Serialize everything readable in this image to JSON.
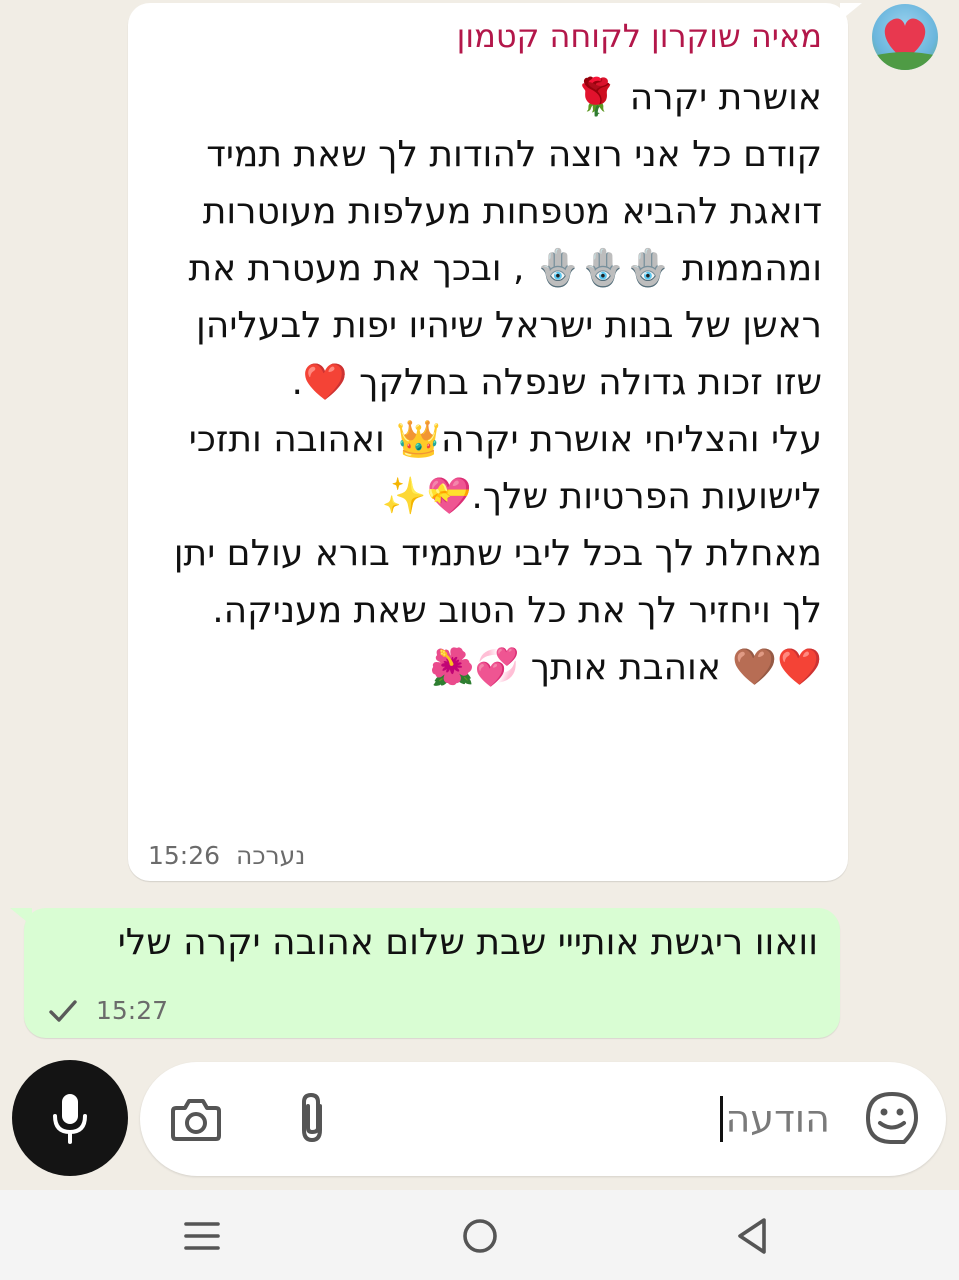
{
  "chat": {
    "incoming": {
      "sender": "מאיה שוקרון לקוחה קטמון",
      "text": "אושרת יקרה 🌹\nקודם כל אני רוצה להודות לך שאת תמיד דואגת להביא מטפחות מעלפות מעוטרות ומהממות 🪬🪬🪬 , ובכך את מעטרת את ראשן של בנות ישראל שיהיו יפות לבעליהן שזו זכות גדולה שנפלה בחלקך ❤️.\nעלי והצליחי אושרת יקרה👑 ואהובה ותזכי לישועות הפרטיות שלך.💝✨\nמאחלת לך בכל ליבי שתמיד בורא עולם יתן לך ויחזיר לך את כל הטוב שאת מעניקה.\n❤️🤎 אוהבת אותך 💞🌺",
      "edited_label": "נערכה",
      "time": "15:26"
    },
    "outgoing": {
      "text": "וואוו ריגשת אותייי שבת שלום אהובה יקרה שלי",
      "time": "15:27",
      "status_icon": "single-check-icon"
    }
  },
  "composer": {
    "placeholder": "הודעה",
    "icons": [
      "sticker-icon",
      "paperclip-icon",
      "camera-icon",
      "microphone-icon"
    ]
  },
  "nav": {
    "icons": [
      "recent-apps-icon",
      "home-icon",
      "back-icon"
    ]
  },
  "colors": {
    "chat_background": "#f1ede5",
    "incoming_bubble": "#ffffff",
    "outgoing_bubble": "#d9fdd3",
    "sender_name": "#b3174a",
    "mic_button": "#141414"
  }
}
